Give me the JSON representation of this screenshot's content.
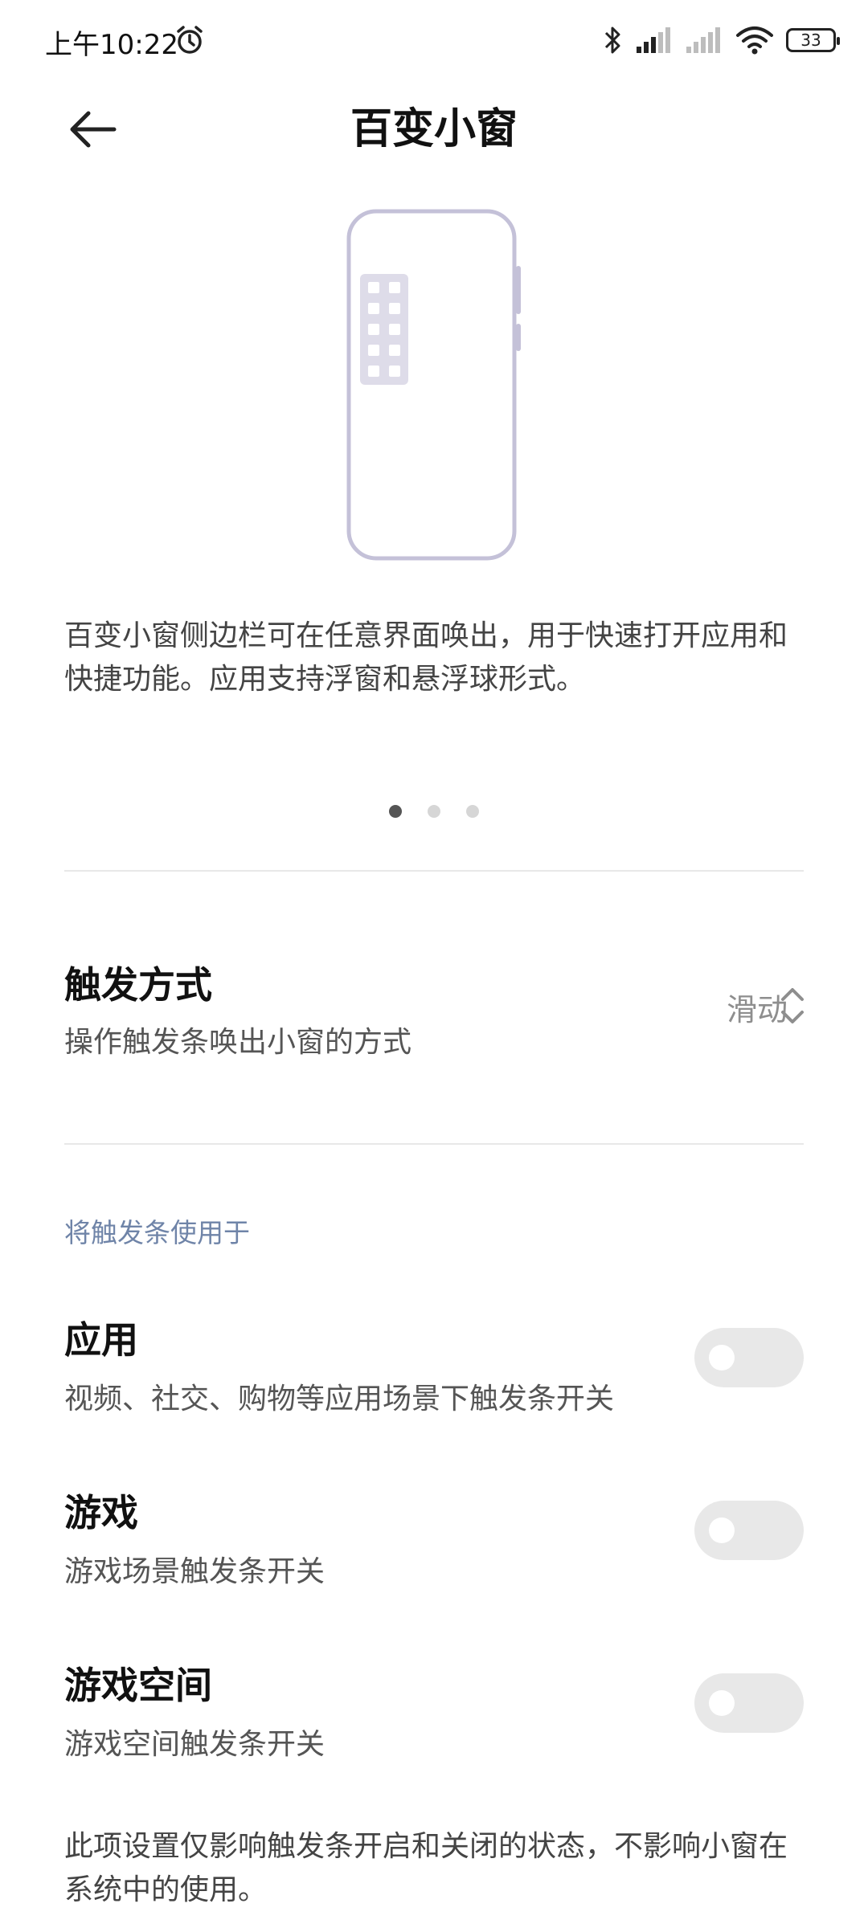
{
  "status_bar": {
    "time": "上午10:22",
    "battery": "33",
    "icons": [
      "alarm-icon",
      "bluetooth-icon",
      "signal-icon",
      "signal-icon",
      "wifi-icon",
      "battery-icon"
    ]
  },
  "header": {
    "title": "百变小窗",
    "back_icon": "back-arrow-icon"
  },
  "intro": {
    "description": "百变小窗侧边栏可在任意界面唤出，用于快速打开应用和快捷功能。应用支持浮窗和悬浮球形式。",
    "page_indicator": {
      "count": 3,
      "active": 1
    }
  },
  "trigger": {
    "title": "触发方式",
    "subtitle": "操作触发条唤出小窗的方式",
    "value": "滑动"
  },
  "section": {
    "label": "将触发条使用于"
  },
  "toggles": [
    {
      "title": "应用",
      "subtitle": "视频、社交、购物等应用场景下触发条开关",
      "on": false
    },
    {
      "title": "游戏",
      "subtitle": "游戏场景触发条开关",
      "on": false
    },
    {
      "title": "游戏空间",
      "subtitle": "游戏空间触发条开关",
      "on": false
    }
  ],
  "footnote": "此项设置仅影响触发条开启和关闭的状态，不影响小窗在系统中的使用。",
  "colors": {
    "accent_label": "#6f84a8",
    "illustration_stroke": "#c4c1d8",
    "illustration_fill": "#dedce9",
    "toggle_off": "#e8e8e8"
  }
}
